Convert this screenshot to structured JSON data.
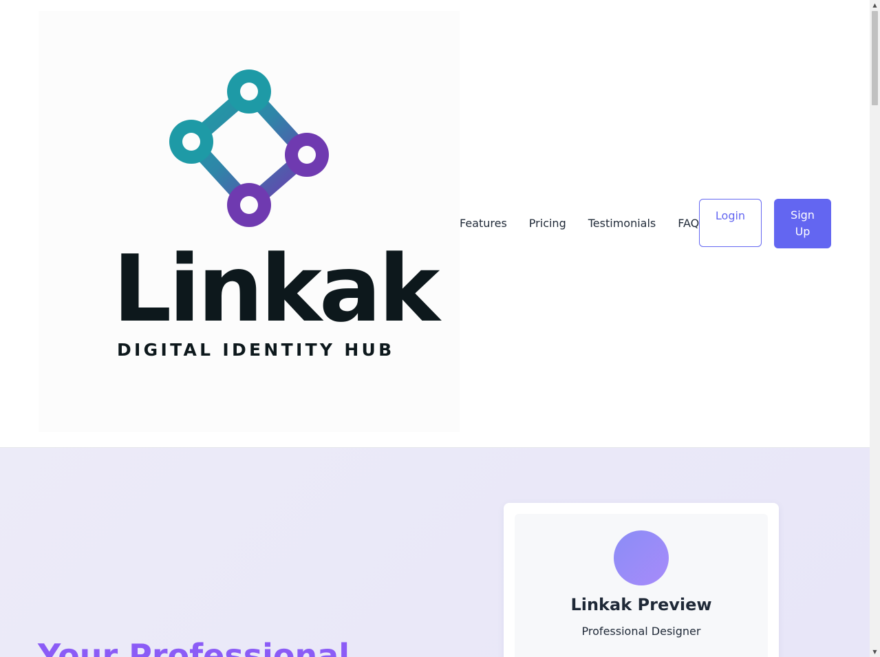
{
  "header": {
    "logo": {
      "wordmark": "Linkak",
      "tagline": "DIGITAL IDENTITY HUB",
      "colors": {
        "teal": "#1e9aa6",
        "purple": "#6f3ab0",
        "text": "#0d181c"
      }
    },
    "nav": [
      {
        "label": "Features"
      },
      {
        "label": "Pricing"
      },
      {
        "label": "Testimonials"
      },
      {
        "label": "FAQ"
      }
    ],
    "login_label": "Login",
    "signup_label": "Sign Up"
  },
  "hero": {
    "title": "Your Professional",
    "preview": {
      "name": "Linkak Preview",
      "role": "Professional Designer"
    }
  },
  "colors": {
    "accent": "#6366f1",
    "heading_accent": "#8b5cf6"
  }
}
